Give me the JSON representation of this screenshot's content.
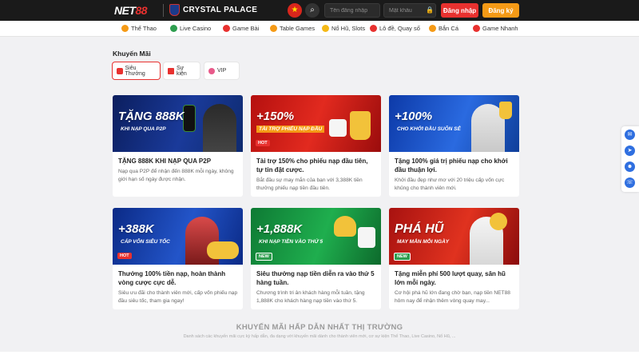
{
  "header": {
    "logo_prefix": "NET",
    "logo_suffix": "88",
    "partner": "CRYSTAL PALACE",
    "username_placeholder": "Tên đăng nhập",
    "password_placeholder": "Mật khẩu",
    "login_label": "Đăng nhập",
    "register_label": "Đăng ký"
  },
  "nav": {
    "items": [
      {
        "label": "Thể Thao",
        "icon": "soccer-ball-icon",
        "color": "#f59a16"
      },
      {
        "label": "Live Casino",
        "icon": "casino-chip-icon",
        "color": "#2e9e4f"
      },
      {
        "label": "Game Bài",
        "icon": "cards-icon",
        "color": "#e8312f"
      },
      {
        "label": "Table Games",
        "icon": "table-icon",
        "color": "#f59a16"
      },
      {
        "label": "Nổ Hũ, Slots",
        "icon": "slot-icon",
        "color": "#f5b916"
      },
      {
        "label": "Lô đề, Quay số",
        "icon": "lottery-icon",
        "color": "#e8312f"
      },
      {
        "label": "Bắn Cá",
        "icon": "fish-icon",
        "color": "#f59a16"
      },
      {
        "label": "Game Nhanh",
        "icon": "rocket-icon",
        "color": "#e8312f"
      }
    ]
  },
  "promotions": {
    "title": "Khuyến Mãi",
    "tabs": [
      {
        "label": "Siêu Thưởng"
      },
      {
        "label": "Sự kiện"
      },
      {
        "label": "VIP"
      }
    ],
    "cards": [
      {
        "banner_big": "TẶNG 888K",
        "banner_tag": "KHI NẠP QUA P2P",
        "badge": "",
        "title": "TẶNG 888K KHI NẠP QUA P2P",
        "desc": "Nạp qua P2P để nhận đến 888K mỗi ngày, không giới hạn số ngày được nhận."
      },
      {
        "banner_big": "+150%",
        "banner_tag": "TÀI TRỢ PHIẾU NẠP ĐẦU",
        "badge": "HOT",
        "title": "Tài trợ 150% cho phiếu nạp đầu tiên, tự tin đặt cược.",
        "desc": "Bắt đầu sự may mắn của bạn với 3,388K tiền thưởng phiếu nạp tiền đầu tiên."
      },
      {
        "banner_big": "+100%",
        "banner_tag": "CHO KHỞI ĐẦU SUÔN SẺ",
        "badge": "",
        "title": "Tặng 100% giá trị phiếu nạp cho khởi đầu thuận lợi.",
        "desc": "Khởi đầu đẹp như mơ với 20 triệu cấp vốn cực khủng cho thành viên mới."
      },
      {
        "banner_big": "+388K",
        "banner_tag": "CẤP VỐN SIÊU TỐC",
        "badge": "HOT",
        "title": "Thưởng 100% tiền nạp, hoàn thành vòng cược cực dễ.",
        "desc": "Siêu ưu đãi cho thành viên mới, cấp vốn phiếu nạp đầu siêu tốc, tham gia ngay!"
      },
      {
        "banner_big": "+1,888K",
        "banner_tag": "KHI NẠP TIỀN VÀO THỨ 5",
        "badge": "NEW",
        "title": "Siêu thưởng nạp tiền diễn ra vào thứ 5 hàng tuần.",
        "desc": "Chương trình tri ân khách hàng mỗi tuần, tặng 1,888K cho khách hàng nạp tiền vào thứ 5."
      },
      {
        "banner_big": "PHÁ HŨ",
        "banner_tag": "MAY MẮN MỖI NGÀY",
        "badge": "NEW",
        "title": "Tặng miễn phí 500 lượt quay, săn hũ lớn mỗi ngày.",
        "desc": "Cơ hội phá hũ lớn đang chờ bạn, nạp tiền NET88 hôm nay để nhận thêm vòng quay may..."
      }
    ]
  },
  "footer": {
    "heading": "KHUYẾN MÃI HẤP DẪN NHẤT THỊ TRƯỜNG",
    "desc": "Danh sách các khuyến mãi cực kỳ hấp dẫn, đa dạng với khuyến mãi dành cho thành viên mới, cơ sự kiện Thể Thao, Live Casino, Nổ Hũ, ..."
  },
  "colors": {
    "brand_red": "#e8312f",
    "brand_orange": "#f59a16",
    "header_bg": "#1a1a1a"
  }
}
